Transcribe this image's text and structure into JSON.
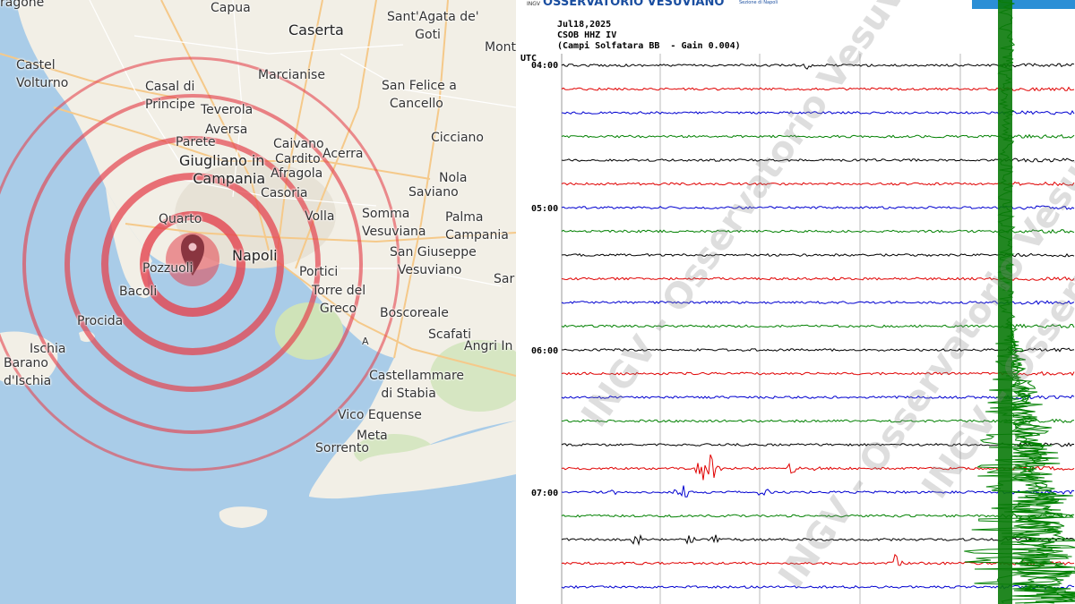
{
  "map": {
    "places": [
      {
        "id": "agone",
        "text": "ragone"
      },
      {
        "id": "capua",
        "text": "Capua"
      },
      {
        "id": "caserta",
        "text": "Caserta"
      },
      {
        "id": "santagata",
        "text": "Sant'Agata de'\n       Goti"
      },
      {
        "id": "monti",
        "text": "Mont"
      },
      {
        "id": "castel-volturno",
        "text": "Castel\nVolturno"
      },
      {
        "id": "marcianise",
        "text": "Marcianise"
      },
      {
        "id": "casal",
        "text": "Casal di\nPrincipe"
      },
      {
        "id": "teverola",
        "text": "Teverola"
      },
      {
        "id": "san-felice",
        "text": "San Felice a\n  Cancello"
      },
      {
        "id": "aversa",
        "text": "Aversa"
      },
      {
        "id": "parete",
        "text": "Parete"
      },
      {
        "id": "caivano",
        "text": "Caivano"
      },
      {
        "id": "acerra",
        "text": "Acerra"
      },
      {
        "id": "cicciano",
        "text": "Cicciano"
      },
      {
        "id": "cardito",
        "text": "Cardito"
      },
      {
        "id": "giugliano",
        "text": "Giugliano in\n   Campania"
      },
      {
        "id": "afragola",
        "text": "Afragola"
      },
      {
        "id": "nola",
        "text": "Nola"
      },
      {
        "id": "casoria",
        "text": "Casoria"
      },
      {
        "id": "saviano",
        "text": "Saviano"
      },
      {
        "id": "quarto",
        "text": "Quarto"
      },
      {
        "id": "volla",
        "text": "Volla"
      },
      {
        "id": "somma",
        "text": "Somma\nVesuviana"
      },
      {
        "id": "palma",
        "text": "Palma\nCampania"
      },
      {
        "id": "napoli",
        "text": "Napoli"
      },
      {
        "id": "pozzuoli",
        "text": "Pozzuoli"
      },
      {
        "id": "sangiuseppe",
        "text": "San Giuseppe\n  Vesuviano"
      },
      {
        "id": "portici",
        "text": "Portici"
      },
      {
        "id": "sar",
        "text": "Sar"
      },
      {
        "id": "bacoli",
        "text": "Bacoli"
      },
      {
        "id": "torre",
        "text": "Torre del\n  Greco"
      },
      {
        "id": "procida",
        "text": "Procida"
      },
      {
        "id": "boscoreale",
        "text": "Boscoreale"
      },
      {
        "id": "scafati",
        "text": "Scafati"
      },
      {
        "id": "a-letter",
        "text": "A"
      },
      {
        "id": "angri",
        "text": "Angri In"
      },
      {
        "id": "ischia",
        "text": "Ischia"
      },
      {
        "id": "barano",
        "text": "Barano\nd'Ischia"
      },
      {
        "id": "castellammare",
        "text": "Castellammare\n   di Stabia"
      },
      {
        "id": "vico",
        "text": "Vico Equense"
      },
      {
        "id": "meta",
        "text": "Meta"
      },
      {
        "id": "sorrento",
        "text": "Sorrento"
      }
    ],
    "accent": "#e4444f"
  },
  "seismogram": {
    "brand": "OSSERVATORIO VESUVIANO",
    "brand_sub": "Sezione di Napoli",
    "ingv": "INGV",
    "date": "Jul18,2025",
    "station": "CSOB HHZ IV",
    "desc": "(Campi Solfatara BB  - Gain 0.004)",
    "utc": "UTC",
    "time_labels": [
      "04:00",
      "05:00",
      "06:00",
      "07:00"
    ],
    "watermark": "INGV - Osservatorio Vesuviano",
    "trace_colors": [
      "#000000",
      "#e00000",
      "#0000d0",
      "#008000"
    ]
  }
}
